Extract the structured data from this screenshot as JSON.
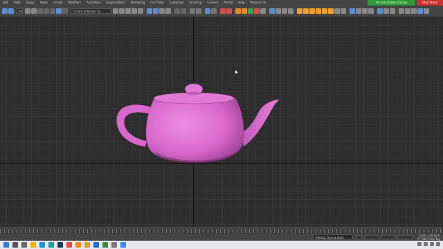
{
  "app": {
    "menu": [
      "Edit",
      "Tools",
      "Group",
      "Views",
      "Create",
      "Modifiers",
      "Animation",
      "Graph Editors",
      "Rendering",
      "Civil View",
      "Customize",
      "Scripting",
      "Content",
      "Arnold",
      "Help",
      "Phoenix FD"
    ]
  },
  "share": {
    "sharing_label": "You are screen sharing",
    "stop_label": "Stop Share"
  },
  "toolbar": {
    "undo_icon": "undo-icon",
    "redo_icon": "redo-icon",
    "filter_label": "All",
    "selection_set_label": "Create Selection Se",
    "accent": "#f0a030"
  },
  "viewport": {
    "object": "teapot",
    "object_color": "#d868cc",
    "grid_visible": true
  },
  "status": {
    "prompt_text": "Editing: Spring body",
    "coord_text": "Grid = 10.0cm",
    "time_tag_text": "Add Time Tag"
  },
  "taskbar": {
    "apps": [
      "windows-start-icon",
      "search-icon",
      "task-view-icon",
      "file-explorer-icon",
      "edge-browser-icon",
      "3dsmax-icon",
      "photoshop-icon",
      "chrome-icon",
      "vray-icon",
      "folder-icon",
      "mail-icon",
      "calendar-icon",
      "settings-icon",
      "zoom-icon"
    ]
  }
}
